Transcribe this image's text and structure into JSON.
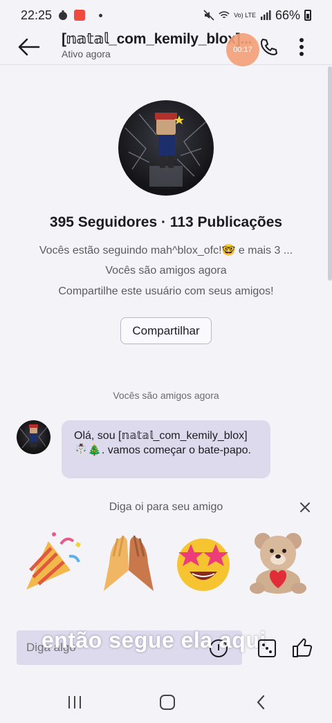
{
  "status_bar": {
    "time": "22:25",
    "battery": "66%",
    "network": "Vo) LTE"
  },
  "header": {
    "title": "[𝕟𝕒𝕥𝕒𝕝_com_kemily_blox]...",
    "status": "Ativo agora",
    "recording_time": "00:17"
  },
  "profile": {
    "stats": "395 Seguidores · 113 Publicações",
    "following": "Vocês estão seguindo mah^blox_ofc!🤓 e mais 3 ...",
    "friends": "Vocês são amigos agora",
    "share_prompt": "Compartilhe este usuário com seus amigos!",
    "share_button": "Compartilhar"
  },
  "chat": {
    "divider": "Vocês são amigos agora",
    "message": "Olá, sou [𝕟𝕒𝕥𝕒𝕝_com_kemily_blox] ☃️🎄. vamos começar o bate-papo."
  },
  "wave": {
    "label": "Diga oi para seu amigo",
    "stickers": [
      "party-popper",
      "high-five",
      "star-struck",
      "teddy-bear"
    ]
  },
  "composer": {
    "placeholder": "Diga algo",
    "caption": "então segue ela aqui"
  },
  "colors": {
    "background": "#f4f3f7",
    "bubble": "#dcdaec",
    "accent_record": "#f3a077"
  }
}
